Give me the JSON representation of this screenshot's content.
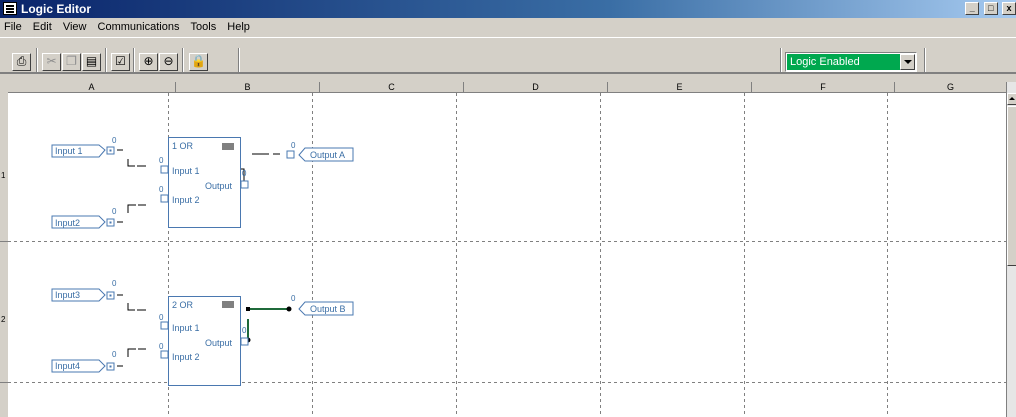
{
  "window": {
    "title": "Logic Editor",
    "controls": [
      "_",
      "□",
      "x"
    ]
  },
  "menu": [
    "File",
    "Edit",
    "View",
    "Communications",
    "Tools",
    "Help"
  ],
  "toolbar": {
    "buttons": [
      "print-icon",
      "cut-icon",
      "copy-icon",
      "paste-icon",
      "edit-check-icon",
      "zoom-in-icon",
      "zoom-out-icon",
      "lock-icon"
    ],
    "mode_select": {
      "value": "Logic Enabled",
      "color": "#00a84f"
    }
  },
  "grid": {
    "columns": [
      "A",
      "B",
      "C",
      "D",
      "E",
      "F",
      "G"
    ],
    "rows": [
      "1",
      "2"
    ]
  },
  "blocks": [
    {
      "header": "1  OR",
      "in1_label": "Input 1",
      "in2_label": "Input 2",
      "out_label": "Output",
      "in1_val": "0",
      "in2_val": "0",
      "out_val": "0",
      "inputs": [
        {
          "label": "Input 1",
          "value": "0"
        },
        {
          "label": "Input2",
          "value": "0"
        }
      ],
      "output": {
        "label": "Output A",
        "value": "0"
      }
    },
    {
      "header": "2  OR",
      "in1_label": "Input 1",
      "in2_label": "Input 2",
      "out_label": "Output",
      "in1_val": "0",
      "in2_val": "0",
      "out_val": "0",
      "inputs": [
        {
          "label": "Input3",
          "value": "0"
        },
        {
          "label": "Input4",
          "value": "0"
        }
      ],
      "output": {
        "label": "Output B",
        "value": "0"
      }
    }
  ],
  "colors": {
    "block_stroke": "#4a78b0",
    "block_text": "#3a6ea5",
    "wire": "#000000",
    "wire_selected": "#1f6a3a"
  }
}
